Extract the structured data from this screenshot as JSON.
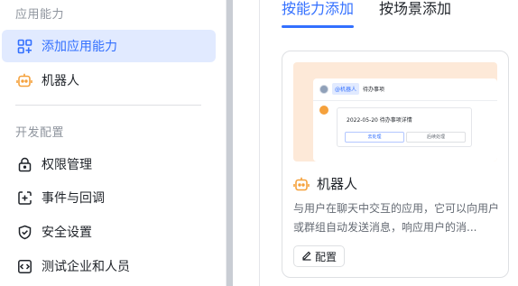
{
  "sidebar": {
    "section1_title": "应用能力",
    "add_capability": "添加应用能力",
    "bot": "机器人",
    "section2_title": "开发配置",
    "items": [
      "权限管理",
      "事件与回调",
      "安全设置",
      "测试企业和人员"
    ]
  },
  "tabs": [
    "按能力添加",
    "按场景添加"
  ],
  "card": {
    "preview": {
      "mention": "@机器人",
      "topic": "待办事项",
      "task_text": "2022-05-20 待办事项详情",
      "btn_primary": "去处理",
      "btn_secondary": "后续处理"
    },
    "title": "机器人",
    "description": "与用户在聊天中交互的应用，它可以向用户或群组自动发送消息，响应用户的消...",
    "config_button": "配置"
  },
  "colors": {
    "accent": "#3370ff",
    "active_bg": "#e1eaff",
    "bot_orange": "#f5a13c",
    "preview_bg": "#fde9d8"
  }
}
